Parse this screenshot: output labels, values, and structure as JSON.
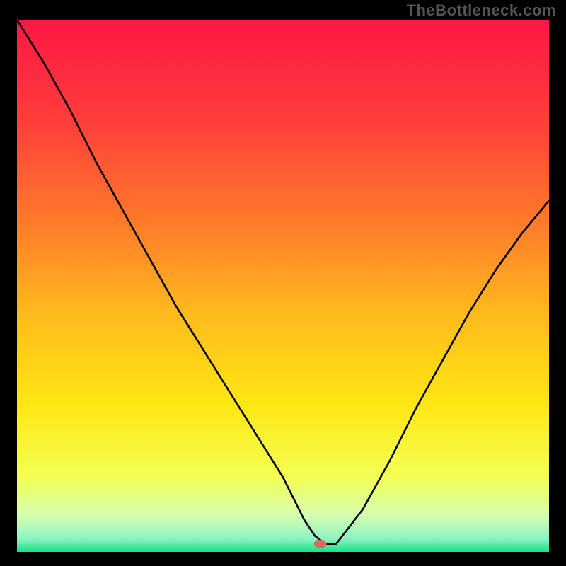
{
  "watermark": "TheBottleneck.com",
  "chart_data": {
    "type": "line",
    "title": "",
    "xlabel": "",
    "ylabel": "",
    "xlim": [
      0,
      100
    ],
    "ylim": [
      0,
      100
    ],
    "grid": false,
    "legend": false,
    "background_gradient": {
      "stops": [
        {
          "offset": 0.0,
          "color": "#ff1744"
        },
        {
          "offset": 0.18,
          "color": "#ff3b3b"
        },
        {
          "offset": 0.38,
          "color": "#ff7a2a"
        },
        {
          "offset": 0.55,
          "color": "#ffb91e"
        },
        {
          "offset": 0.72,
          "color": "#ffe612"
        },
        {
          "offset": 0.86,
          "color": "#f3ff55"
        },
        {
          "offset": 0.93,
          "color": "#d6ffb0"
        },
        {
          "offset": 0.975,
          "color": "#8ef2c2"
        },
        {
          "offset": 1.0,
          "color": "#17e28a"
        }
      ]
    },
    "curve": {
      "x": [
        0,
        5,
        10,
        15,
        20,
        25,
        30,
        35,
        40,
        45,
        50,
        52,
        54,
        56,
        58,
        60,
        65,
        70,
        75,
        80,
        85,
        90,
        95,
        100
      ],
      "y": [
        100,
        92,
        83,
        73,
        64,
        55,
        46,
        38,
        30,
        22,
        14,
        10,
        6,
        3,
        1.5,
        1.5,
        8,
        17,
        27,
        36,
        45,
        53,
        60,
        66
      ]
    },
    "marker": {
      "x": 57,
      "y": 1.5,
      "color": "#e0655c",
      "rx": 9,
      "ry": 6
    }
  }
}
